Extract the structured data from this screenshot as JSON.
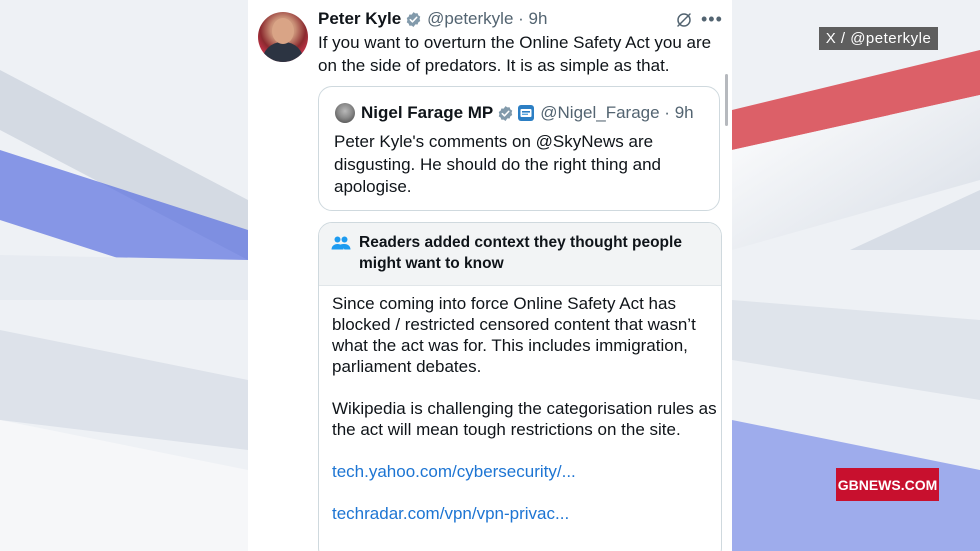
{
  "overlay": {
    "source_tag": "X / @peterkyle",
    "brand_tag": "GBNEWS.COM"
  },
  "tweet": {
    "author_name": "Peter Kyle",
    "handle_time": "@peterkyle · 9h",
    "text": "If you want to overturn the Online Safety Act you are on the side of predators. It is as simple as that.",
    "quoted": {
      "author_name": "Nigel Farage MP",
      "handle_time": "@Nigel_Farage · 9h",
      "text": "Peter Kyle's comments on @SkyNews are disgusting. He should do the right thing and apologise."
    },
    "community_note": {
      "title": "Readers added context they thought people might want to know",
      "paragraph_1": "Since coming into force Online Safety Act has blocked / restricted censored content that wasn’t what the act was for. This includes immigration, parliament debates.",
      "paragraph_2": "Wikipedia is challenging the categorisation rules as the act will mean tough restrictions on the site.",
      "links": [
        "tech.yahoo.com/cybersecurity/...",
        "techradar.com/vpn/vpn-privac..."
      ]
    }
  },
  "icons": {
    "verified": "verified-badge-icon",
    "grok": "grok-icon",
    "more": "more-icon",
    "affiliation": "affiliation-badge-icon",
    "people": "people-icon"
  },
  "colors": {
    "verified": "#829aab",
    "link": "#1d75d3",
    "brand": "#c8102e",
    "note_header": "#f2f4f5"
  }
}
